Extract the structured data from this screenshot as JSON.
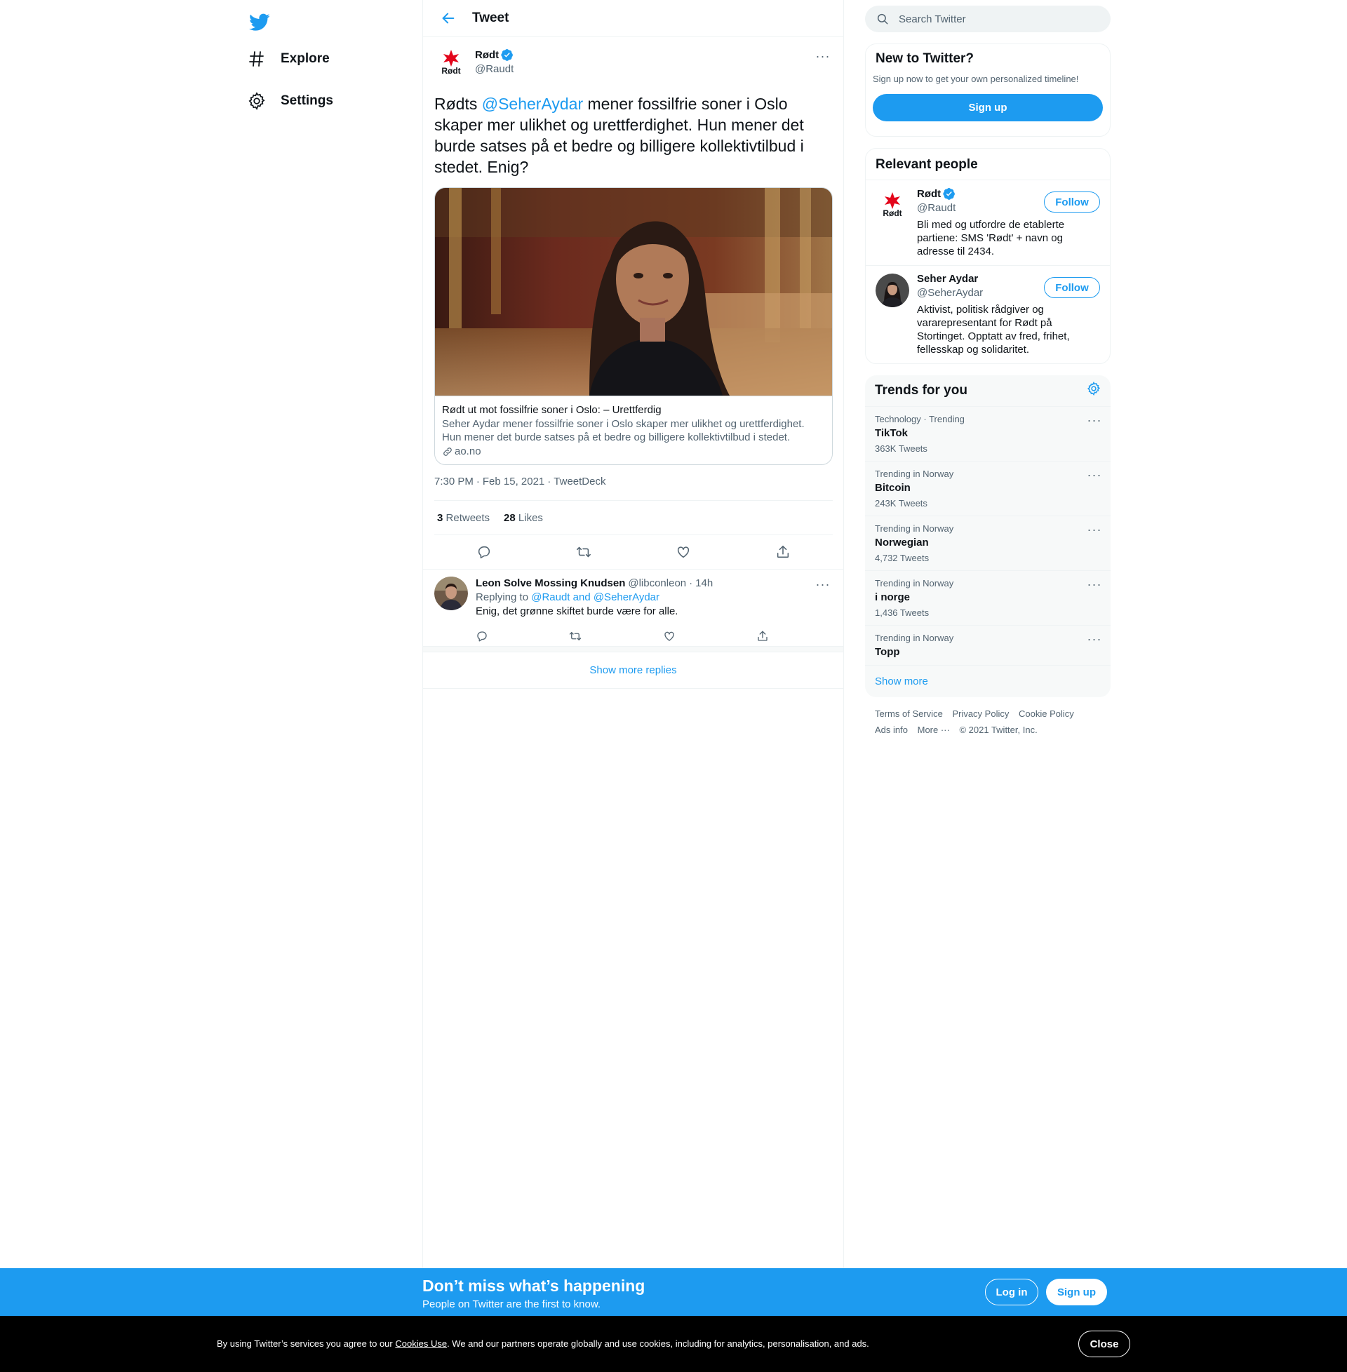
{
  "colors": {
    "accent": "#1d9bf0",
    "text": "#0f1419",
    "muted": "#536471",
    "rodt_red": "#e3051b"
  },
  "nav": {
    "logo": "twitter-bird-icon",
    "items": [
      {
        "label": "Explore",
        "icon": "hashtag-icon"
      },
      {
        "label": "Settings",
        "icon": "gear-icon"
      }
    ]
  },
  "header": {
    "title": "Tweet"
  },
  "tweet": {
    "author_name": "Rødt",
    "author_handle": "@Raudt",
    "text_before": "Rødts ",
    "mention": "@SeherAydar",
    "text_after": " mener fossilfrie soner i Oslo skaper mer ulikhet og urettferdighet. Hun mener det burde satses på et bedre og billigere kollektivtilbud i stedet. Enig?",
    "card": {
      "title": "Rødt ut mot fossilfrie soner i Oslo: – Urettferdig",
      "description": "Seher Aydar mener fossilfrie soner i Oslo skaper mer ulikhet og urettferdighet. Hun mener det burde satses på et bedre og billigere kollektivtilbud i stedet.",
      "domain": "ao.no"
    },
    "time": "7:30 PM",
    "date": "Feb 15, 2021",
    "source": "TweetDeck",
    "retweets": "3",
    "retweets_label": "Retweets",
    "likes": "28",
    "likes_label": "Likes"
  },
  "reply": {
    "name": "Leon Solve Mossing Knudsen",
    "handle": "@libconleon",
    "time": "14h",
    "replying_prefix": "Replying to ",
    "replying_to": "@Raudt and @SeherAydar",
    "text": "Enig, det grønne skiftet burde være for alle."
  },
  "show_more_replies": "Show more replies",
  "search": {
    "placeholder": "Search Twitter"
  },
  "signup_panel": {
    "title": "New to Twitter?",
    "subtitle": "Sign up now to get your own personalized timeline!",
    "button": "Sign up"
  },
  "relevant_people": {
    "title": "Relevant people",
    "people": [
      {
        "name": "Rødt",
        "handle": "@Raudt",
        "verified": true,
        "bio": "Bli med og utfordre de etablerte partiene: SMS 'Rødt' + navn og adresse til 2434.",
        "follow": "Follow"
      },
      {
        "name": "Seher Aydar",
        "handle": "@SeherAydar",
        "verified": false,
        "bio": "Aktivist, politisk rådgiver og vararepresentant for Rødt på Stortinget. Opptatt av fred, frihet, fellesskap og solidaritet.",
        "follow": "Follow"
      }
    ]
  },
  "trends": {
    "title": "Trends for you",
    "items": [
      {
        "category": "Technology · Trending",
        "name": "TikTok",
        "count": "363K Tweets"
      },
      {
        "category": "Trending in Norway",
        "name": "Bitcoin",
        "count": "243K Tweets"
      },
      {
        "category": "Trending in Norway",
        "name": "Norwegian",
        "count": "4,732 Tweets"
      },
      {
        "category": "Trending in Norway",
        "name": "i norge",
        "count": "1,436 Tweets"
      },
      {
        "category": "Trending in Norway",
        "name": "Topp",
        "count": ""
      }
    ],
    "show_more": "Show more"
  },
  "footer": {
    "links": [
      "Terms of Service",
      "Privacy Policy",
      "Cookie Policy",
      "Ads info",
      "More ···",
      "© 2021 Twitter, Inc."
    ]
  },
  "bottom_bar": {
    "title": "Don’t miss what’s happening",
    "subtitle": "People on Twitter are the first to know.",
    "login": "Log in",
    "signup": "Sign up"
  },
  "cookie_bar": {
    "text_before": "By using Twitter’s services you agree to our ",
    "link": "Cookies Use",
    "text_after": ". We and our partners operate globally and use cookies, including for analytics, personalisation, and ads.",
    "close": "Close"
  }
}
